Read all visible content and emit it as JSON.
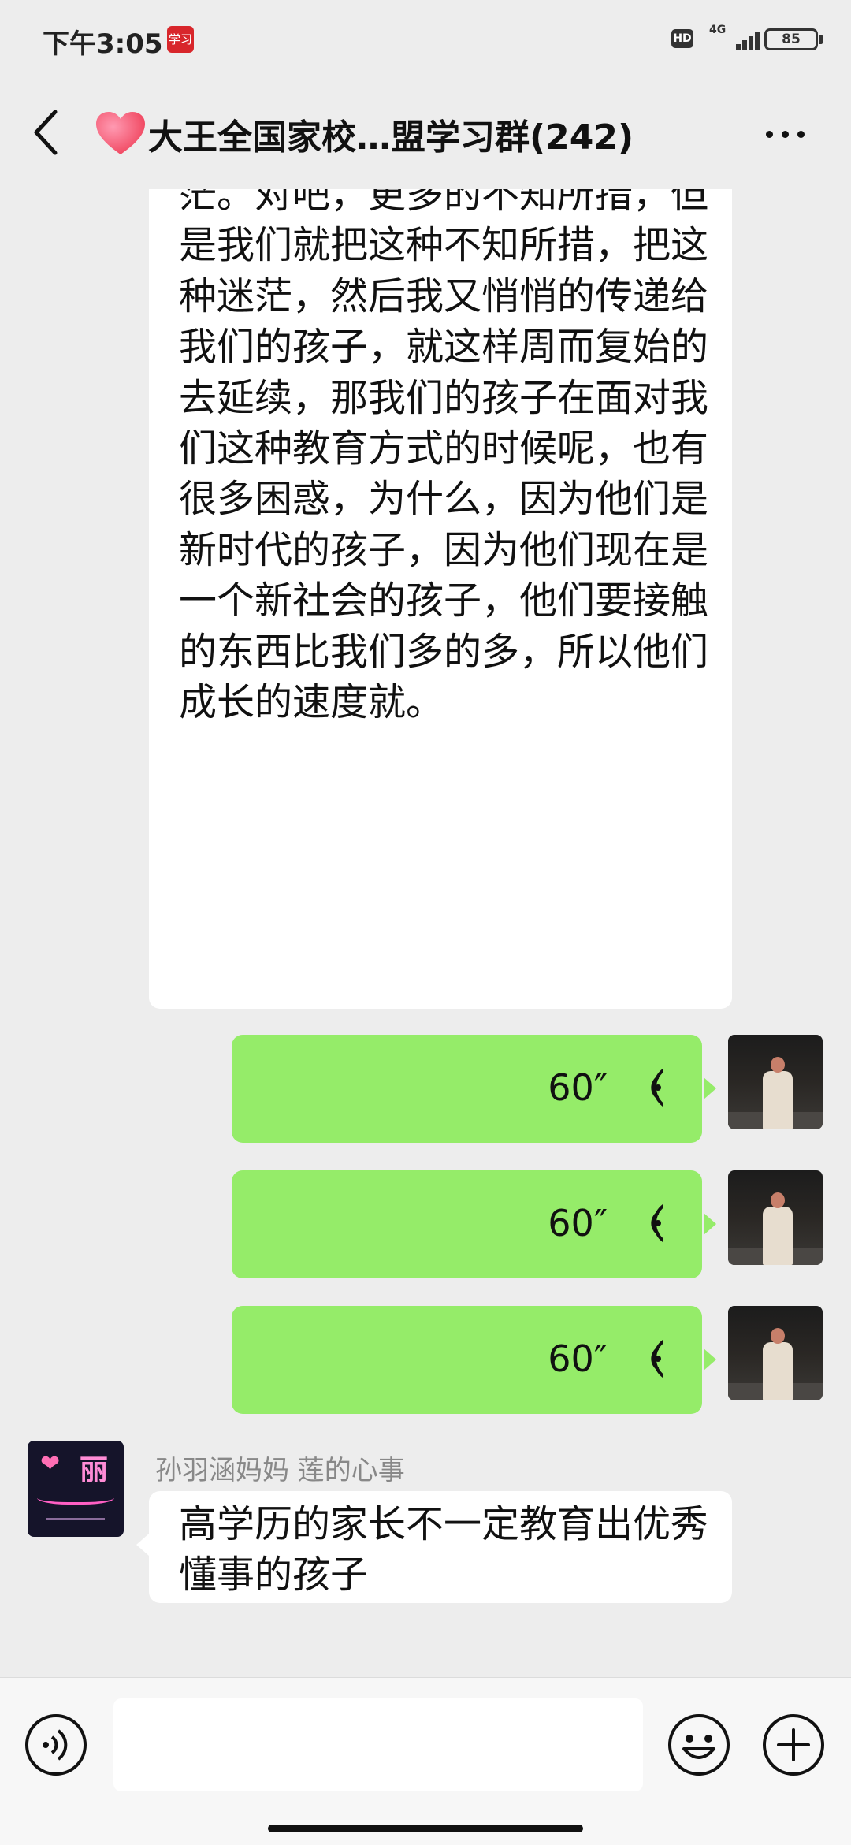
{
  "status_bar": {
    "time": "下午3:05",
    "app_badge": "学习",
    "hd": "HD",
    "network": "4G",
    "battery": "85"
  },
  "header": {
    "title": "大王全国家校…盟学习群(242)",
    "icons": [
      "back-icon",
      "heart-icon",
      "more-icon"
    ]
  },
  "messages": [
    {
      "type": "text",
      "direction": "incoming",
      "text": "茫。对吧，更多的不知所措，但是我们就把这种不知所措，把这种迷茫，然后我又悄悄的传递给我们的孩子，就这样周而复始的去延续，那我们的孩子在面对我们这种教育方式的时候呢，也有很多困惑，为什么，因为他们是新时代的孩子，因为他们现在是一个新社会的孩子，他们要接触的东西比我们多的多，所以他们成长的速度就。"
    },
    {
      "type": "voice",
      "direction": "outgoing",
      "duration": "60″"
    },
    {
      "type": "voice",
      "direction": "outgoing",
      "duration": "60″"
    },
    {
      "type": "voice",
      "direction": "outgoing",
      "duration": "60″"
    },
    {
      "type": "text",
      "direction": "incoming",
      "sender": "孙羽涵妈妈  莲的心事",
      "avatar_text": "丽",
      "text": "高学历的家长不一定教育出优秀懂事的孩子"
    }
  ],
  "input_bar": {
    "placeholder": "",
    "icons": [
      "voice-toggle-icon",
      "emoji-icon",
      "plus-icon"
    ]
  },
  "colors": {
    "background": "#ededed",
    "outgoing_bubble": "#95ec69",
    "incoming_bubble": "#ffffff"
  }
}
